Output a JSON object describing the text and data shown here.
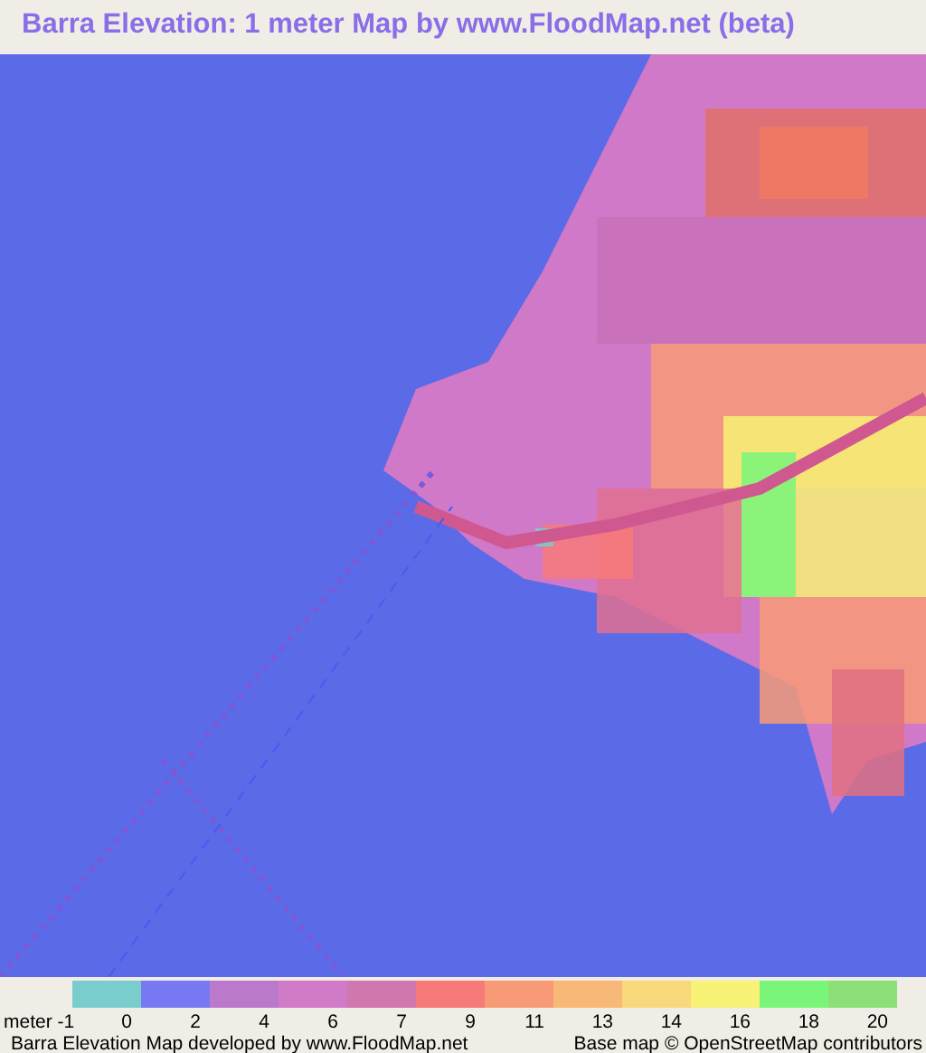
{
  "title": "Barra Elevation: 1 meter Map by www.FloodMap.net (beta)",
  "legend": {
    "unit_label": "meter -1",
    "swatches": [
      {
        "color": "#79cdcd",
        "label": "0"
      },
      {
        "color": "#7878f2",
        "label": "2"
      },
      {
        "color": "#bb79cc",
        "label": "4"
      },
      {
        "color": "#d07ac8",
        "label": "6"
      },
      {
        "color": "#d077ae",
        "label": "7"
      },
      {
        "color": "#f77a7a",
        "label": "9"
      },
      {
        "color": "#f89a76",
        "label": "11"
      },
      {
        "color": "#f8b978",
        "label": "13"
      },
      {
        "color": "#f8d87a",
        "label": "14"
      },
      {
        "color": "#f7f276",
        "label": "16"
      },
      {
        "color": "#79f679",
        "label": "18"
      },
      {
        "color": "#8be177",
        "label": "20"
      }
    ]
  },
  "footer": {
    "credit": "Barra Elevation Map developed by www.FloodMap.net",
    "attribution": "Base map © OpenStreetMap contributors"
  }
}
